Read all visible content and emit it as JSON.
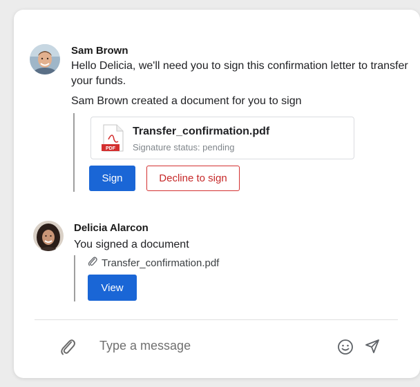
{
  "messages": [
    {
      "sender": "Sam Brown",
      "text_line1": "Hello Delicia, we'll need you to sign this confirmation letter to transfer",
      "text_line2": "your funds.",
      "event": "Sam Brown created a document for you to sign",
      "file": {
        "name": "Transfer_confirmation.pdf",
        "status": "Signature status: pending",
        "icon_label": "PDF"
      },
      "actions": {
        "sign_label": "Sign",
        "decline_label": "Decline to sign"
      }
    },
    {
      "sender": "Delicia Alarcon",
      "event": "You signed a document",
      "attachment": "Transfer_confirmation.pdf",
      "actions": {
        "view_label": "View"
      }
    }
  ],
  "composer": {
    "placeholder": "Type a message",
    "attach_icon": "paperclip-icon",
    "emoji_icon": "smiley-icon",
    "send_icon": "send-icon"
  },
  "colors": {
    "primary": "#1a66d6",
    "danger": "#d32f2f"
  }
}
